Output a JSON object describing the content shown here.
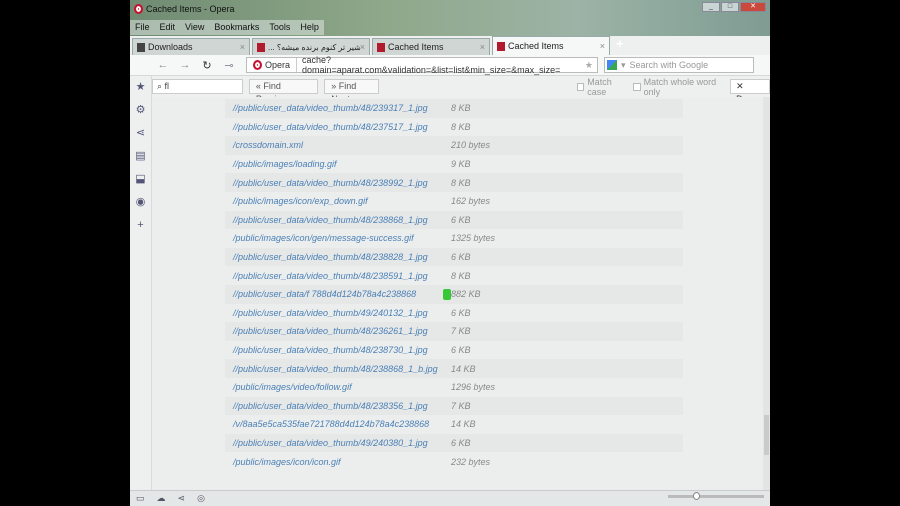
{
  "window": {
    "title": "Cached Items - Opera"
  },
  "menu": [
    "File",
    "Edit",
    "View",
    "Bookmarks",
    "Tools",
    "Help"
  ],
  "tabs": [
    {
      "label": "Downloads"
    },
    {
      "label": "... شیر تر کنوم برنده میشه؟"
    },
    {
      "label": "Cached Items"
    },
    {
      "label": "Cached Items"
    }
  ],
  "address": {
    "badge": "Opera",
    "url": "cache?domain=aparat.com&validation=&list=list&min_size=&max_size=",
    "search_placeholder": "Search with Google"
  },
  "find": {
    "query": "fl",
    "prev": "Find Previous",
    "next": "Find Next",
    "match_case": "Match case",
    "whole_word": "Match whole word only",
    "done": "Done"
  },
  "items": [
    {
      "url": "//public/user_data/video_thumb/48/239317_1.jpg",
      "size": "8 KB"
    },
    {
      "url": "//public/user_data/video_thumb/48/237517_1.jpg",
      "size": "8 KB"
    },
    {
      "url": "/crossdomain.xml",
      "size": "210 bytes"
    },
    {
      "url": "//public/images/loading.gif",
      "size": "9 KB"
    },
    {
      "url": "//public/user_data/video_thumb/48/238992_1.jpg",
      "size": "8 KB"
    },
    {
      "url": "//public/images/icon/exp_down.gif",
      "size": "162 bytes"
    },
    {
      "url": "//public/user_data/video_thumb/48/238868_1.jpg",
      "size": "6 KB"
    },
    {
      "url": "/public/images/icon/gen/message-success.gif",
      "size": "1325 bytes"
    },
    {
      "url": "//public/user_data/video_thumb/48/238828_1.jpg",
      "size": "6 KB"
    },
    {
      "url": "//public/user_data/video_thumb/48/238591_1.jpg",
      "size": "8 KB"
    },
    {
      "url": "//public/user_data/f    788d4d124b78a4c238868",
      "size": "882 KB",
      "highlight": true
    },
    {
      "url": "//public/user_data/video_thumb/49/240132_1.jpg",
      "size": "6 KB"
    },
    {
      "url": "//public/user_data/video_thumb/48/236261_1.jpg",
      "size": "7 KB"
    },
    {
      "url": "//public/user_data/video_thumb/48/238730_1.jpg",
      "size": "6 KB"
    },
    {
      "url": "//public/user_data/video_thumb/48/238868_1_b.jpg",
      "size": "14 KB"
    },
    {
      "url": "/public/images/video/follow.gif",
      "size": "1296 bytes"
    },
    {
      "url": "//public/user_data/video_thumb/48/238356_1.jpg",
      "size": "7 KB"
    },
    {
      "url": "/v/8aa5e5ca535fae721788d4d124b78a4c238868",
      "size": "14 KB"
    },
    {
      "url": "//public/user_data/video_thumb/49/240380_1.jpg",
      "size": "6 KB"
    },
    {
      "url": "/public/images/icon/icon.gif",
      "size": "232 bytes"
    }
  ]
}
